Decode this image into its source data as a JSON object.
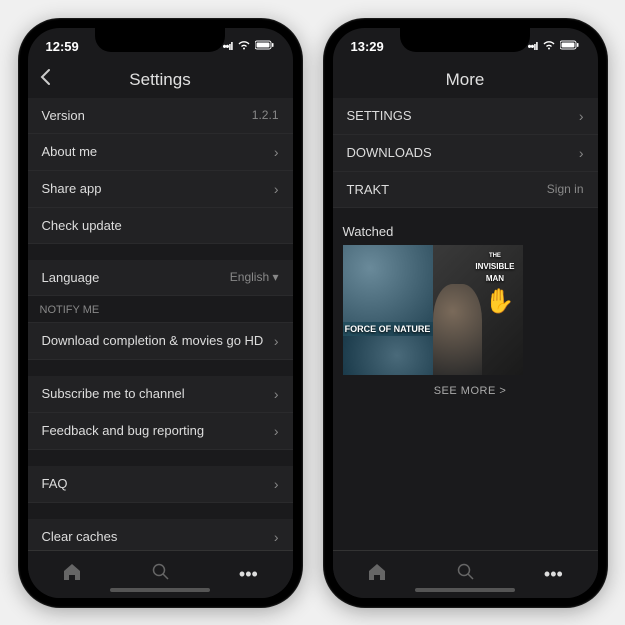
{
  "phone1": {
    "time": "12:59",
    "title": "Settings",
    "rows": {
      "version_label": "Version",
      "version_value": "1.2.1",
      "about": "About me",
      "share": "Share app",
      "check_update": "Check update",
      "language_label": "Language",
      "language_value": "English ▾",
      "notify_header": "NOTIFY ME",
      "download_hd": "Download completion & movies go HD",
      "subscribe": "Subscribe me to channel",
      "feedback": "Feedback and bug reporting",
      "faq": "FAQ",
      "clear": "Clear caches"
    }
  },
  "phone2": {
    "time": "13:29",
    "title": "More",
    "rows": {
      "settings": "SETTINGS",
      "downloads": "DOWNLOADS",
      "trakt_label": "TRAKT",
      "trakt_value": "Sign in"
    },
    "watched": "Watched",
    "poster1": "FORCE OF NATURE",
    "poster2a": "THE",
    "poster2b": "INVISIBLE",
    "poster2c": "MAN",
    "see_more": "SEE MORE >"
  }
}
